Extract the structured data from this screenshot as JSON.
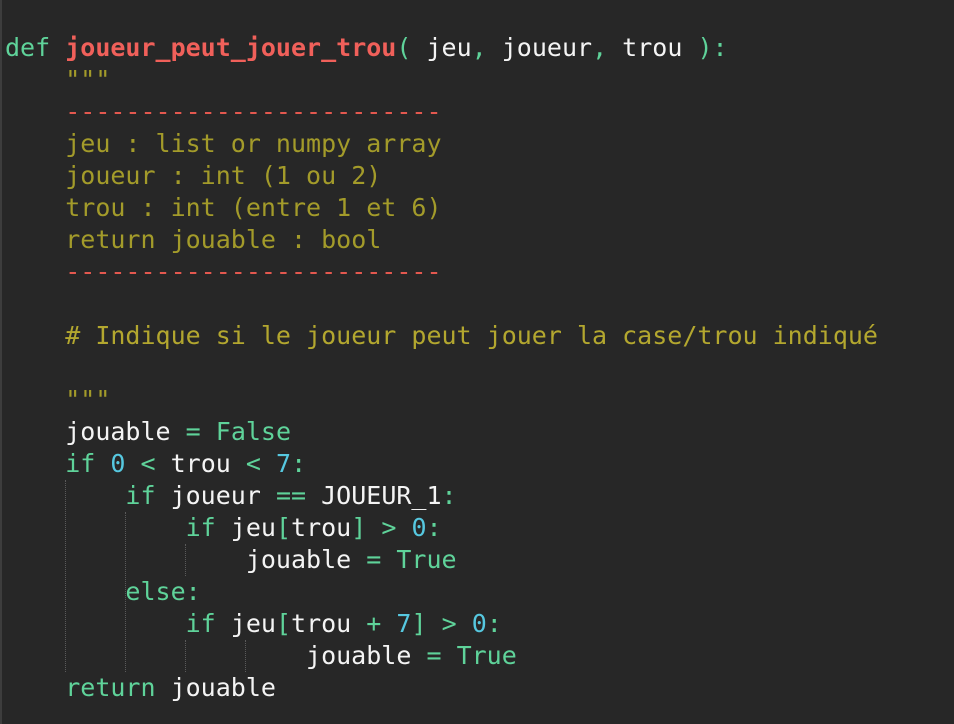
{
  "editor": {
    "lines": [
      {
        "indent": "",
        "tokens": [
          {
            "t": "def",
            "c": "kw"
          },
          {
            "t": " ",
            "c": "txt"
          },
          {
            "t": "joueur_peut_jouer_trou",
            "c": "fn"
          },
          {
            "t": "(",
            "c": "kw"
          },
          {
            "t": " jeu",
            "c": "txt"
          },
          {
            "t": ",",
            "c": "kw"
          },
          {
            "t": " joueur",
            "c": "txt"
          },
          {
            "t": ",",
            "c": "kw"
          },
          {
            "t": " trou ",
            "c": "txt"
          },
          {
            "t": "):",
            "c": "kw"
          }
        ]
      },
      {
        "indent": "    ",
        "tokens": [
          {
            "t": "\"\"\"",
            "c": "str"
          }
        ]
      },
      {
        "indent": "    ",
        "tokens": [
          {
            "t": "-------------------------",
            "c": "sep"
          }
        ]
      },
      {
        "indent": "    ",
        "tokens": [
          {
            "t": "jeu : list or numpy array",
            "c": "str"
          }
        ]
      },
      {
        "indent": "    ",
        "tokens": [
          {
            "t": "joueur : int (1 ou 2)",
            "c": "str"
          }
        ]
      },
      {
        "indent": "    ",
        "tokens": [
          {
            "t": "trou : int (entre 1 et 6)",
            "c": "str"
          }
        ]
      },
      {
        "indent": "    ",
        "tokens": [
          {
            "t": "return jouable : bool",
            "c": "str"
          }
        ]
      },
      {
        "indent": "    ",
        "tokens": [
          {
            "t": "-------------------------",
            "c": "sep"
          }
        ]
      },
      {
        "indent": "",
        "tokens": []
      },
      {
        "indent": "    ",
        "tokens": [
          {
            "t": "# Indique si le joueur peut jouer la case/trou indiqué",
            "c": "cmt"
          }
        ]
      },
      {
        "indent": "",
        "tokens": []
      },
      {
        "indent": "    ",
        "tokens": [
          {
            "t": "\"\"\"",
            "c": "str"
          }
        ]
      },
      {
        "indent": "    ",
        "tokens": [
          {
            "t": "jouable ",
            "c": "txt"
          },
          {
            "t": "=",
            "c": "op"
          },
          {
            "t": " ",
            "c": "txt"
          },
          {
            "t": "False",
            "c": "kw"
          }
        ]
      },
      {
        "indent": "    ",
        "tokens": [
          {
            "t": "if",
            "c": "kw"
          },
          {
            "t": " ",
            "c": "txt"
          },
          {
            "t": "0",
            "c": "num"
          },
          {
            "t": " ",
            "c": "txt"
          },
          {
            "t": "<",
            "c": "op"
          },
          {
            "t": " trou ",
            "c": "txt"
          },
          {
            "t": "<",
            "c": "op"
          },
          {
            "t": " ",
            "c": "txt"
          },
          {
            "t": "7",
            "c": "num"
          },
          {
            "t": ":",
            "c": "kw"
          }
        ]
      },
      {
        "indent": "        ",
        "tokens": [
          {
            "t": "if",
            "c": "kw"
          },
          {
            "t": " joueur ",
            "c": "txt"
          },
          {
            "t": "==",
            "c": "op"
          },
          {
            "t": " JOUEUR_1",
            "c": "txt"
          },
          {
            "t": ":",
            "c": "kw"
          }
        ]
      },
      {
        "indent": "            ",
        "tokens": [
          {
            "t": "if",
            "c": "kw"
          },
          {
            "t": " jeu",
            "c": "txt"
          },
          {
            "t": "[",
            "c": "kw"
          },
          {
            "t": "trou",
            "c": "txt"
          },
          {
            "t": "]",
            "c": "kw"
          },
          {
            "t": " ",
            "c": "txt"
          },
          {
            "t": ">",
            "c": "op"
          },
          {
            "t": " ",
            "c": "txt"
          },
          {
            "t": "0",
            "c": "num"
          },
          {
            "t": ":",
            "c": "kw"
          }
        ]
      },
      {
        "indent": "                ",
        "tokens": [
          {
            "t": "jouable ",
            "c": "txt"
          },
          {
            "t": "=",
            "c": "op"
          },
          {
            "t": " ",
            "c": "txt"
          },
          {
            "t": "True",
            "c": "kw"
          }
        ]
      },
      {
        "indent": "        ",
        "tokens": [
          {
            "t": "else:",
            "c": "kw"
          }
        ]
      },
      {
        "indent": "            ",
        "tokens": [
          {
            "t": "if",
            "c": "kw"
          },
          {
            "t": " jeu",
            "c": "txt"
          },
          {
            "t": "[",
            "c": "kw"
          },
          {
            "t": "trou ",
            "c": "txt"
          },
          {
            "t": "+",
            "c": "op"
          },
          {
            "t": " ",
            "c": "txt"
          },
          {
            "t": "7",
            "c": "num"
          },
          {
            "t": "]",
            "c": "kw"
          },
          {
            "t": " ",
            "c": "txt"
          },
          {
            "t": ">",
            "c": "op"
          },
          {
            "t": " ",
            "c": "txt"
          },
          {
            "t": "0",
            "c": "num"
          },
          {
            "t": ":",
            "c": "kw"
          }
        ]
      },
      {
        "indent": "                    ",
        "tokens": [
          {
            "t": "jouable ",
            "c": "txt"
          },
          {
            "t": "=",
            "c": "op"
          },
          {
            "t": " ",
            "c": "txt"
          },
          {
            "t": "True",
            "c": "kw"
          }
        ]
      },
      {
        "indent": "    ",
        "tokens": [
          {
            "t": "return",
            "c": "kw"
          },
          {
            "t": " jouable",
            "c": "txt"
          }
        ]
      }
    ]
  }
}
